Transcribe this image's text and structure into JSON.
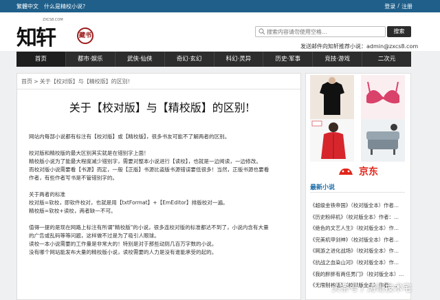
{
  "topbar": {
    "left_links": [
      "繁體中文",
      "什么是精校小说？"
    ],
    "right_links": [
      "登录",
      "/",
      "注册"
    ]
  },
  "logo": {
    "main_text": "知轩",
    "stamp_text": "藏书",
    "domain_text": "ZXCS8.COM"
  },
  "search": {
    "placeholder": "搜索内容请勿使用空格...",
    "button_label": "搜索"
  },
  "mail_line": "发送邮件向知轩推荐小说：admin@zxcs8.com",
  "nav": {
    "items": [
      "首页",
      "都市·娱乐",
      "武侠·仙侠",
      "奇幻·玄幻",
      "科幻·灵异",
      "历史·军事",
      "竞技·游戏",
      "二次元"
    ],
    "active_index": 0
  },
  "breadcrumb": {
    "home": "首页",
    "separator": ">",
    "current": "关于【校对版】与【精校版】的区别!"
  },
  "article": {
    "title": "关于【校对版】与【精校版】的区别!",
    "paragraphs": [
      [
        "网站内每部小说都有标注有【校对版】或【精校版】，很多书友可能不了解两者的区别。"
      ],
      [
        "校对版和精校版的最大区别其实就是在错别字上面！",
        "精校版小说为了能最大程度减少错别字，需要对整本小说进行【读校】，也就是一边阅读，一边修改。",
        "而校对版小说需要看【书源】而定，一般【正版】书源比盗版书源错误要低很多！当然，正版书源也要看",
        "作者，有些作者写书是不管错别字的。"
      ],
      [
        "关于两者的标准",
        "校对版=软校，即软件校对，也就是用【txtFormat】+【EmEditor】排版校对一遍。",
        "精校版=软校+读校，两者缺一不可。"
      ],
      [
        "值得一提的是现在网路上标注有所谓\"精校版\"的小说，很多连校对版的标准都达不到了，小说内含有大量",
        "的广告或乱码等等问题，这样做不过是为了吸引人眼球。",
        "读校一本小说需要的工作量是非常大的！特别是对于那些动则几百万字数的小说。",
        "没有哪个网站能发布大量的精校版小说，读校需要的人力是没有谁能承受的起的。"
      ]
    ]
  },
  "sidebar": {
    "ad_brand": "京东",
    "section_title": "最新小说",
    "items": [
      "《超级金铁帝国》（校对版全本）作者...",
      "《历史粉碎机》（校对版全本）作者：...",
      "《绝色的文艺人生》（校对版全本）作...",
      "《完美机甲剑神》（校对版全本）作者...",
      "《网游之进化战场》（校对版全本）作...",
      "《抗战之血染山河》（校对版全本）作...",
      "《我的胖胖有两任男门》（校对版全本）...",
      "《无限制神话》（校对版全本）作者：..."
    ]
  },
  "watermark": "头条号 / 涛哥技术宅",
  "colors": {
    "topbar": "#1f5f8a",
    "nav": "#2d2d2d",
    "accent": "#1f6fa8",
    "jd_red": "#e1251b"
  }
}
